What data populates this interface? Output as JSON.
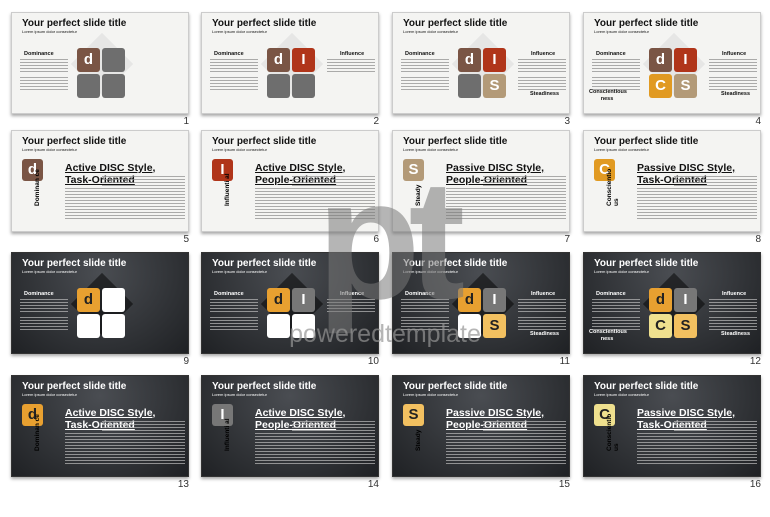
{
  "slide_title": "Your perfect slide title",
  "slide_subtitle": "Lorem ipsum dolor consectetur",
  "labels": {
    "d": "Dominance",
    "i": "Influence",
    "s": "Steadiness",
    "c": "Conscientious ness"
  },
  "colors": {
    "light": {
      "d": "#7a5545",
      "i": "#b0351a",
      "c": "#e19a22",
      "s": "#b39a78",
      "empty": "#6e6e6e"
    },
    "dark": {
      "d": "#e8a030",
      "i": "#777777",
      "c": "#efe08e",
      "s": "#f2c060",
      "empty": "#ffffff"
    }
  },
  "slides": [
    {
      "num": "1",
      "theme": "light",
      "type": "diagram",
      "shown": [
        "d"
      ]
    },
    {
      "num": "2",
      "theme": "light",
      "type": "diagram",
      "shown": [
        "d",
        "i"
      ]
    },
    {
      "num": "3",
      "theme": "light",
      "type": "diagram",
      "shown": [
        "d",
        "i",
        "s"
      ]
    },
    {
      "num": "4",
      "theme": "light",
      "type": "diagram",
      "shown": [
        "d",
        "i",
        "s",
        "c"
      ]
    },
    {
      "num": "5",
      "theme": "light",
      "type": "detail",
      "key": "d",
      "letter": "d",
      "vlabel": "Dominan ce",
      "heading": "Active DISC Style, Task-Oriented"
    },
    {
      "num": "6",
      "theme": "light",
      "type": "detail",
      "key": "i",
      "letter": "I",
      "vlabel": "Influenti al",
      "heading": "Active DISC Style, People-Oriented"
    },
    {
      "num": "7",
      "theme": "light",
      "type": "detail",
      "key": "s",
      "letter": "S",
      "vlabel": "Steady",
      "heading": "Passive DISC Style, People-Oriented"
    },
    {
      "num": "8",
      "theme": "light",
      "type": "detail",
      "key": "c",
      "letter": "C",
      "vlabel": "Conscientio us",
      "heading": "Passive DISC Style, Task-Oriented"
    },
    {
      "num": "9",
      "theme": "dark",
      "type": "diagram",
      "shown": [
        "d"
      ]
    },
    {
      "num": "10",
      "theme": "dark",
      "type": "diagram",
      "shown": [
        "d",
        "i"
      ]
    },
    {
      "num": "11",
      "theme": "dark",
      "type": "diagram",
      "shown": [
        "d",
        "i",
        "s"
      ]
    },
    {
      "num": "12",
      "theme": "dark",
      "type": "diagram",
      "shown": [
        "d",
        "i",
        "s",
        "c"
      ]
    },
    {
      "num": "13",
      "theme": "dark",
      "type": "detail",
      "key": "d",
      "letter": "d",
      "vlabel": "Dominan ce",
      "heading": "Active DISC Style, Task-Oriented"
    },
    {
      "num": "14",
      "theme": "dark",
      "type": "detail",
      "key": "i",
      "letter": "I",
      "vlabel": "Influenti al",
      "heading": "Active DISC Style, People-Oriented"
    },
    {
      "num": "15",
      "theme": "dark",
      "type": "detail",
      "key": "s",
      "letter": "S",
      "vlabel": "Steady",
      "heading": "Passive DISC Style, People-Oriented"
    },
    {
      "num": "16",
      "theme": "dark",
      "type": "detail",
      "key": "c",
      "letter": "C",
      "vlabel": "Conscientio us",
      "heading": "Passive DISC Style, Task-Oriented"
    }
  ],
  "letters": {
    "d": "d",
    "i": "I",
    "s": "S",
    "c": "C"
  },
  "watermark": {
    "logo": "pt",
    "text": "poweredtemplate"
  }
}
